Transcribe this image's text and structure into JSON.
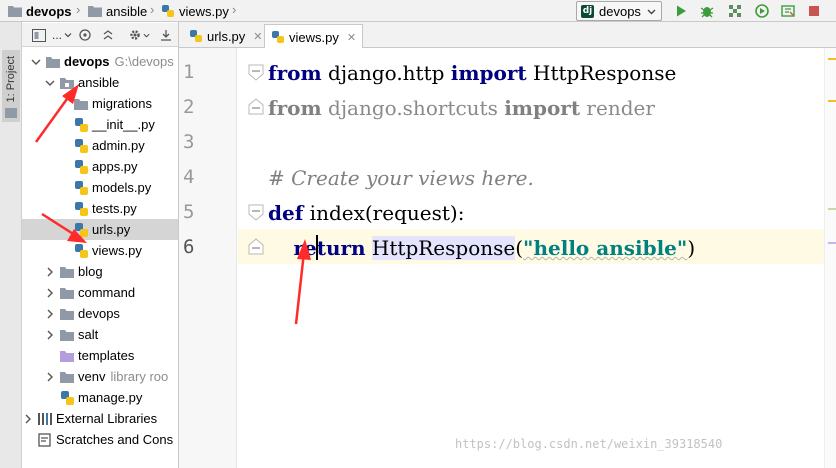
{
  "navbar": {
    "breadcrumbs": [
      "devops",
      "ansible",
      "views.py"
    ],
    "run_config": "devops",
    "icons": [
      "run-icon",
      "debug-icon",
      "coverage-icon",
      "profile-icon",
      "build-icon",
      "stop-icon"
    ]
  },
  "stripe": {
    "project_tab": "1: Project"
  },
  "project_panel": {
    "toolbar": {
      "view_label": "..."
    },
    "tree": [
      {
        "label": "devops",
        "hint": "G:\\devops",
        "type": "root",
        "expanded": true
      },
      {
        "label": "ansible",
        "type": "folder",
        "expanded": true
      },
      {
        "label": "migrations",
        "type": "folder"
      },
      {
        "label": "__init__.py",
        "type": "py"
      },
      {
        "label": "admin.py",
        "type": "py"
      },
      {
        "label": "apps.py",
        "type": "py"
      },
      {
        "label": "models.py",
        "type": "py"
      },
      {
        "label": "tests.py",
        "type": "py"
      },
      {
        "label": "urls.py",
        "type": "py",
        "selected": true
      },
      {
        "label": "views.py",
        "type": "py"
      },
      {
        "label": "blog",
        "type": "folder",
        "collapsed": true
      },
      {
        "label": "command",
        "type": "folder",
        "collapsed": true
      },
      {
        "label": "devops",
        "type": "folder",
        "collapsed": true
      },
      {
        "label": "salt",
        "type": "folder",
        "collapsed": true
      },
      {
        "label": "templates",
        "type": "folder-purple"
      },
      {
        "label": "venv",
        "hint": "library roo",
        "type": "folder",
        "collapsed": true
      },
      {
        "label": "manage.py",
        "type": "py"
      },
      {
        "label": "External Libraries",
        "type": "libs",
        "collapsed": true
      },
      {
        "label": "Scratches and Cons",
        "type": "scratch"
      }
    ]
  },
  "tabs": [
    {
      "label": "urls.py",
      "active": false
    },
    {
      "label": "views.py",
      "active": true
    }
  ],
  "editor": {
    "line_numbers": [
      "1",
      "2",
      "3",
      "4",
      "5",
      "6"
    ],
    "line1": {
      "kw1": "from",
      "mod": " django.http ",
      "kw2": "import",
      "name": " HttpResponse"
    },
    "line2": {
      "kw1": "from",
      "mod": " django.shortcuts ",
      "kw2": "import",
      "name": " render"
    },
    "line4": {
      "comment": "# Create your views here."
    },
    "line5": {
      "kw": "def",
      "sig": " index(request):"
    },
    "line6": {
      "indent": "    ",
      "kw": "return",
      "sp": " ",
      "call": "HttpResponse",
      "open": "(",
      "str": "\"hello ansible\"",
      "close": ")"
    }
  },
  "colors": {
    "keyword": "#000080",
    "string": "#008080",
    "comment": "#808080",
    "arrow": "#ff2a2a",
    "selection": "#d5d5d5"
  },
  "watermark": "https://blog.csdn.net/weixin_39318540"
}
